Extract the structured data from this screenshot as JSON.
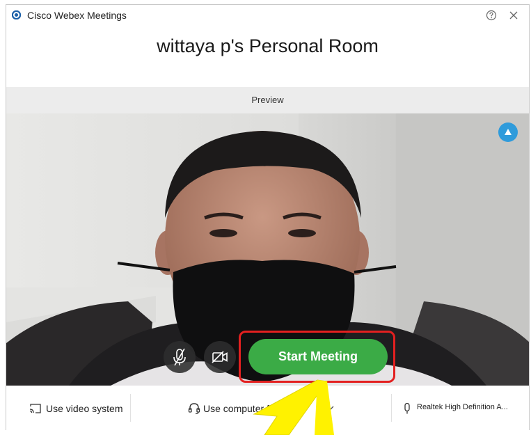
{
  "app": {
    "title": "Cisco Webex Meetings"
  },
  "room": {
    "title": "wittaya p's Personal Room"
  },
  "preview": {
    "label": "Preview"
  },
  "controls": {
    "start_label": "Start Meeting"
  },
  "bottom": {
    "video_system_label": "Use video system",
    "audio_label": "Use computer for a",
    "speaker_label": "Realtek High Definition A..."
  },
  "icons": {
    "app_logo": "webex-logo-icon",
    "help": "help-icon",
    "close": "close-icon",
    "badge": "blue-badge-icon",
    "mute": "microphone-muted-icon",
    "video": "video-off-icon",
    "video_system": "cast-icon",
    "audio": "headset-icon",
    "chevron": "chevron-down-icon",
    "speaker": "speaker-icon"
  },
  "colors": {
    "start_button": "#3bab46",
    "highlight": "#e32020",
    "badge": "#2f9bdb",
    "arrow": "#fff200"
  }
}
